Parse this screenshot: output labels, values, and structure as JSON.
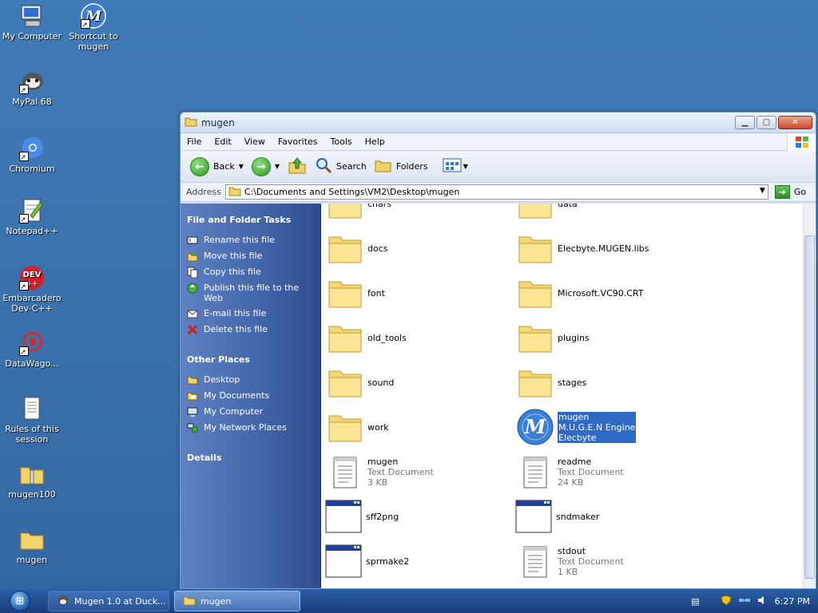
{
  "desktop": {
    "icons": [
      {
        "label": "My Computer"
      },
      {
        "label": "Shortcut to mugen"
      },
      {
        "label": "MyPal 68"
      },
      {
        "label": "Chromium"
      },
      {
        "label": "Notepad++"
      },
      {
        "label": "Embarcadero Dev-C++"
      },
      {
        "label": "DataWago..."
      },
      {
        "label": "Rules of this session"
      },
      {
        "label": "mugen100"
      },
      {
        "label": "mugen"
      }
    ]
  },
  "window": {
    "title": "mugen",
    "menu": [
      "File",
      "Edit",
      "View",
      "Favorites",
      "Tools",
      "Help"
    ],
    "toolbar": {
      "back": "Back",
      "search": "Search",
      "folders": "Folders"
    },
    "address": {
      "label": "Address",
      "value": "C:\\Documents and Settings\\VM2\\Desktop\\mugen",
      "go": "Go"
    },
    "taskpane": {
      "file_tasks_title": "File and Folder Tasks",
      "file_tasks": [
        "Rename this file",
        "Move this file",
        "Copy this file",
        "Publish this file to the Web",
        "E-mail this file",
        "Delete this file"
      ],
      "other_places_title": "Other Places",
      "other_places": [
        "Desktop",
        "My Documents",
        "My Computer",
        "My Network Places"
      ],
      "details_title": "Details"
    },
    "files": [
      {
        "name": "chars",
        "type": "folder"
      },
      {
        "name": "data",
        "type": "folder"
      },
      {
        "name": "docs",
        "type": "folder"
      },
      {
        "name": "Elecbyte.MUGEN.libs",
        "type": "folder"
      },
      {
        "name": "font",
        "type": "folder"
      },
      {
        "name": "Microsoft.VC90.CRT",
        "type": "folder"
      },
      {
        "name": "old_tools",
        "type": "folder"
      },
      {
        "name": "plugins",
        "type": "folder"
      },
      {
        "name": "sound",
        "type": "folder"
      },
      {
        "name": "stages",
        "type": "folder"
      },
      {
        "name": "work",
        "type": "folder"
      },
      {
        "name": "mugen",
        "line2": "M.U.G.E.N Engine",
        "line3": "Elecbyte",
        "type": "exe"
      },
      {
        "name": "mugen",
        "line2": "Text Document",
        "line3": "3 KB",
        "type": "txt"
      },
      {
        "name": "readme",
        "line2": "Text Document",
        "line3": "24 KB",
        "type": "txt"
      },
      {
        "name": "sff2png",
        "type": "app"
      },
      {
        "name": "sndmaker",
        "type": "app"
      },
      {
        "name": "sprmake2",
        "type": "app"
      },
      {
        "name": "stdout",
        "line2": "Text Document",
        "line3": "1 KB",
        "type": "txt"
      }
    ]
  },
  "taskbar": {
    "buttons": [
      "Mugen 1.0 at Duck...",
      "mugen"
    ],
    "clock": "6:27 PM"
  },
  "colors": {
    "selection": "#316ac5",
    "taskpane": "#3d5ea3",
    "desktop": "#3a6ea5"
  }
}
